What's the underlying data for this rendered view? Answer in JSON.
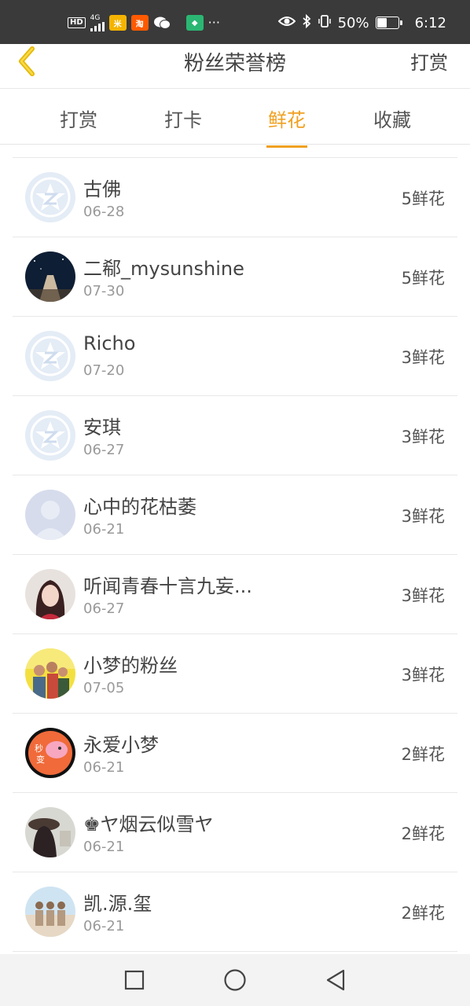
{
  "status_bar": {
    "network": "4G",
    "battery": "50%",
    "battery_level": 0.5,
    "time": "6:12",
    "more": "···"
  },
  "header": {
    "title": "粉丝荣誉榜",
    "right_action": "打赏"
  },
  "tabs": [
    {
      "label": "打赏",
      "active": false
    },
    {
      "label": "打卡",
      "active": false
    },
    {
      "label": "鲜花",
      "active": true
    },
    {
      "label": "收藏",
      "active": false
    }
  ],
  "accent_color": "#f0a020",
  "fans": [
    {
      "name": "古佛",
      "date": "06-28",
      "count": "5鲜花",
      "avatar": "default-star-avatar"
    },
    {
      "name": "二郗_mysunshine",
      "date": "07-30",
      "count": "5鲜花",
      "avatar": "night-sky-photo-avatar"
    },
    {
      "name": "Richo",
      "date": "07-20",
      "count": "3鲜花",
      "avatar": "default-star-avatar"
    },
    {
      "name": "安琪",
      "date": "06-27",
      "count": "3鲜花",
      "avatar": "default-star-avatar"
    },
    {
      "name": "心中的花枯萎",
      "date": "06-21",
      "count": "3鲜花",
      "avatar": "default-person-avatar"
    },
    {
      "name": "听闻青春十言九妄...",
      "date": "06-27",
      "count": "3鲜花",
      "avatar": "girl-photo-avatar"
    },
    {
      "name": "小梦的粉丝",
      "date": "07-05",
      "count": "3鲜花",
      "avatar": "group-photo-avatar"
    },
    {
      "name": "永爱小梦",
      "date": "06-21",
      "count": "2鲜花",
      "avatar": "peppa-pig-avatar"
    },
    {
      "name": "♚ヤ烟云似雪ヤ",
      "date": "06-21",
      "count": "2鲜花",
      "avatar": "hat-girl-photo-avatar"
    },
    {
      "name": "凯.源.玺",
      "date": "06-21",
      "count": "2鲜花",
      "avatar": "three-boys-photo-avatar"
    }
  ]
}
